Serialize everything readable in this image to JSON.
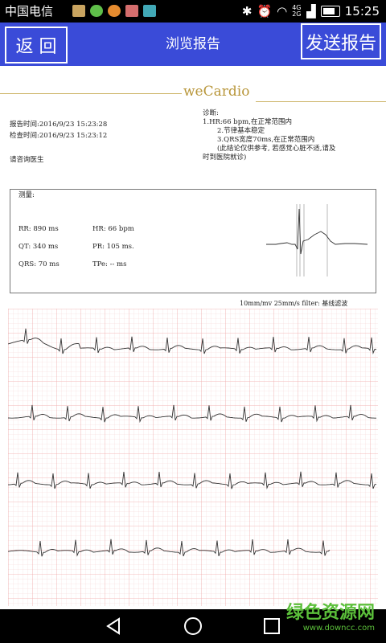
{
  "status_bar": {
    "carrier": "中国电信",
    "network": "4G 2G",
    "time": "15:25"
  },
  "app_bar": {
    "back_label": "返 回",
    "title": "浏览报告",
    "send_label": "发送报告"
  },
  "report": {
    "brand": "weCardio",
    "report_time": "报告时间:2016/9/23 15:23:28",
    "check_time": "检查时间:2016/9/23 15:23:12",
    "doctor": "请咨询医生",
    "diagnosis_title": "诊断:",
    "diagnosis_lines": [
      "1.HR:66 bpm,在正常范围内",
      "2.节律基本稳定",
      "3.QRS宽度70ms,在正常范围内",
      "(此结论仅供参考, 若感觉心脏不适,请及",
      "时到医院就诊)"
    ],
    "measure_title": "测量:",
    "measurements": {
      "rr": "RR:  890 ms",
      "hr": "HR:  66 bpm",
      "qt": "QT:  340 ms",
      "pr": "PR:  105 ms.",
      "qrs": "QRS: 70 ms",
      "tpe": "TPe: -- ms"
    },
    "ecg_params": "10mm/mv  25mm/s  filter: 基线滤波"
  },
  "watermark": {
    "name": "绿色资源网",
    "url": "www.downcc.com"
  },
  "icons": {
    "back": "back-triangle-icon",
    "home": "home-circle-icon",
    "recent": "recent-square-icon"
  },
  "colors": {
    "app_bar": "#3a4bd8",
    "grid": "#f2b7b7",
    "trace": "#333333",
    "brand": "#b8963a",
    "watermark": "#5bbf3a"
  }
}
